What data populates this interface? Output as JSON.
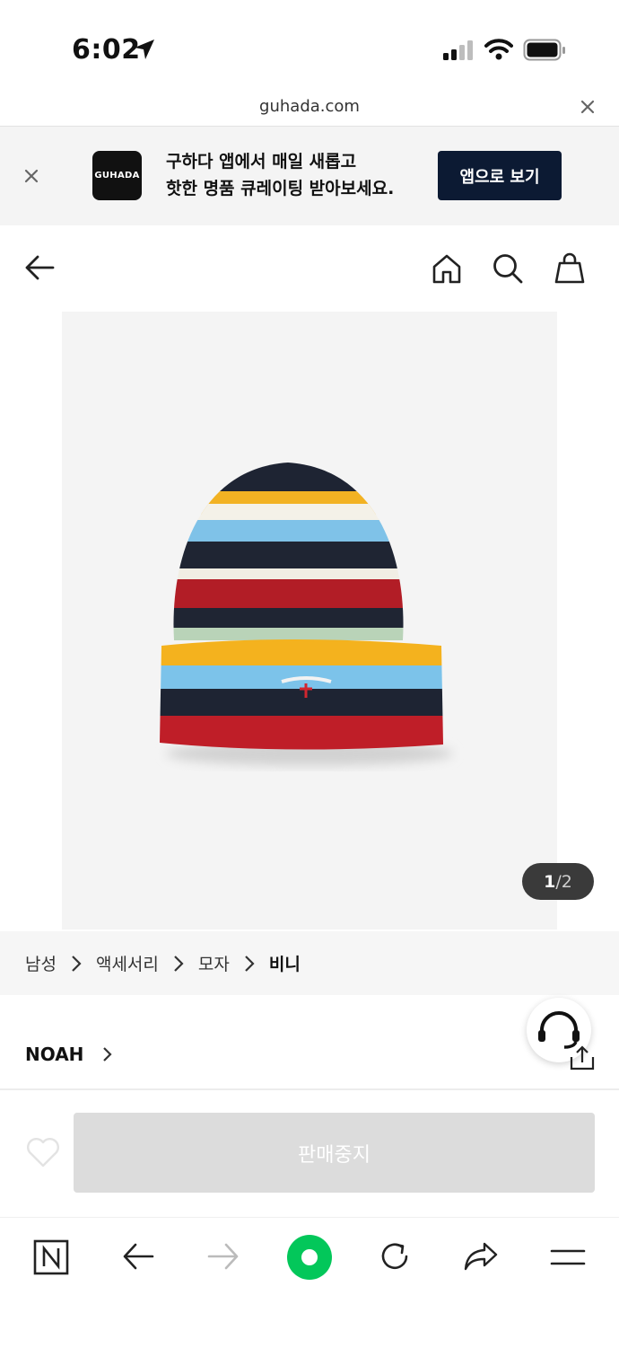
{
  "status_bar": {
    "time": "6:02"
  },
  "browser": {
    "url": "guhada.com"
  },
  "banner": {
    "logo_text": "GUHADA",
    "line1": "구하다 앱에서 매일 새롭고",
    "line2": "핫한 명품 큐레이팅 받아보세요.",
    "open_app_label": "앱으로 보기"
  },
  "gallery": {
    "current": "1",
    "total": "2",
    "separator": "/"
  },
  "breadcrumb": {
    "items": [
      "남성",
      "액세서리",
      "모자",
      "비니"
    ]
  },
  "product": {
    "brand": "NOAH",
    "buy_label": "판매중지"
  },
  "colors": {
    "brand_dark": "#0c1a33",
    "naver_green": "#03c75a",
    "sold_out_gray": "#dcdcdc"
  }
}
